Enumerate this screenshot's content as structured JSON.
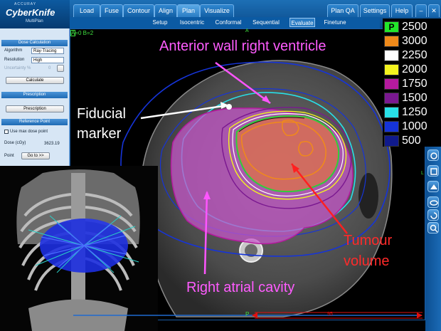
{
  "app": {
    "logo_small": "ACCURAY",
    "logo_name": "CyberKnife",
    "logo_sub": "MultiPlan"
  },
  "tabs": [
    {
      "label": "Load"
    },
    {
      "label": "Fuse"
    },
    {
      "label": "Contour"
    },
    {
      "label": "Align"
    },
    {
      "label": "Plan"
    },
    {
      "label": "Visualize"
    },
    {
      "label": "Plan QA"
    },
    {
      "label": "Settings"
    },
    {
      "label": "Help"
    }
  ],
  "subtabs": [
    {
      "label": "Setup"
    },
    {
      "label": "Isocentric"
    },
    {
      "label": "Conformal"
    },
    {
      "label": "Sequential"
    },
    {
      "label": "Evaluate"
    },
    {
      "label": "Finetune"
    }
  ],
  "left_panel": {
    "dose_calc_title": "Dose Calculation",
    "algorithm_label": "Algorithm",
    "algorithm_value": "Ray-Tracing",
    "resolution_label": "Resolution",
    "resolution_value": "High",
    "uncertainty_label": "Uncertainty %",
    "uncertainty_value": "0",
    "calculate_label": "Calculate",
    "prescription_title": "Prescription",
    "prescription_button": "Prescription",
    "reference_title": "Reference Point",
    "use_max_label": "Use max dose point",
    "dose_label": "Dose (cGy)",
    "dose_value": "3623.19",
    "point_label": "Point",
    "goto_label": "Go to >>"
  },
  "viewer": {
    "ba_text": "A=0  B=2",
    "ba_box": "B",
    "a_marker": "A",
    "p_marker": "P",
    "l_marker": "L",
    "slider_value": "95"
  },
  "legend": {
    "header": "P",
    "header_color": "#22e62a",
    "levels": [
      {
        "value": "2500",
        "color": "#e8471c"
      },
      {
        "value": "3000",
        "color": "#f08a1a"
      },
      {
        "value": "2250",
        "color": "#ffffff"
      },
      {
        "value": "2000",
        "color": "#f3f31e"
      },
      {
        "value": "1750",
        "color": "#b51a9e"
      },
      {
        "value": "1500",
        "color": "#7a1890"
      },
      {
        "value": "1250",
        "color": "#28e0e8"
      },
      {
        "value": "1000",
        "color": "#1634d8"
      },
      {
        "value": "500",
        "color": "#101a8c"
      }
    ]
  },
  "right_tools": [
    "rotate-icon",
    "cube-icon",
    "view-icon",
    "orbit-icon",
    "reset-icon",
    "zoom-icon"
  ],
  "annotations": {
    "anterior": "Anterior wall right ventricle",
    "fiducial_line1": "Fiducial",
    "fiducial_line2": "marker",
    "tumour_line1": "Tumour",
    "tumour_line2": "volume",
    "atrial": "Right atrial cavity"
  }
}
